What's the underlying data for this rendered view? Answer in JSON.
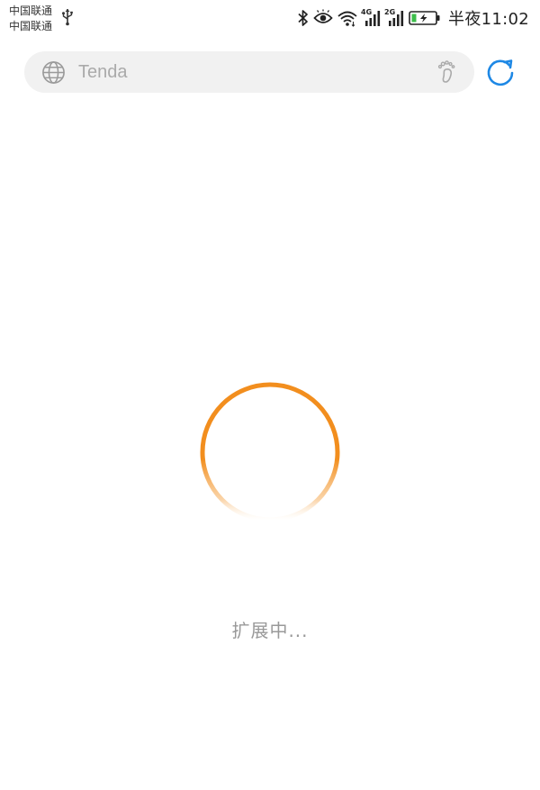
{
  "status_bar": {
    "carrier_1": "中国联通",
    "carrier_2": "中国联通",
    "network_1": "4G",
    "network_2": "2G",
    "time": "半夜11:02",
    "icons": [
      "usb-icon",
      "bluetooth-icon",
      "eye-comfort-icon",
      "wifi-icon",
      "signal-icon",
      "battery-charging-icon"
    ]
  },
  "address_bar": {
    "value": "Tenda",
    "left_icon": "globe-icon",
    "right_icon": "footprint-icon"
  },
  "toolbar": {
    "refresh_icon": "refresh-icon"
  },
  "loading": {
    "text": "扩展中..."
  },
  "colors": {
    "spinner": "#F28E1E",
    "refresh": "#1E88E5",
    "address_bar_bg": "#F1F1F1",
    "muted_text": "#999999"
  }
}
